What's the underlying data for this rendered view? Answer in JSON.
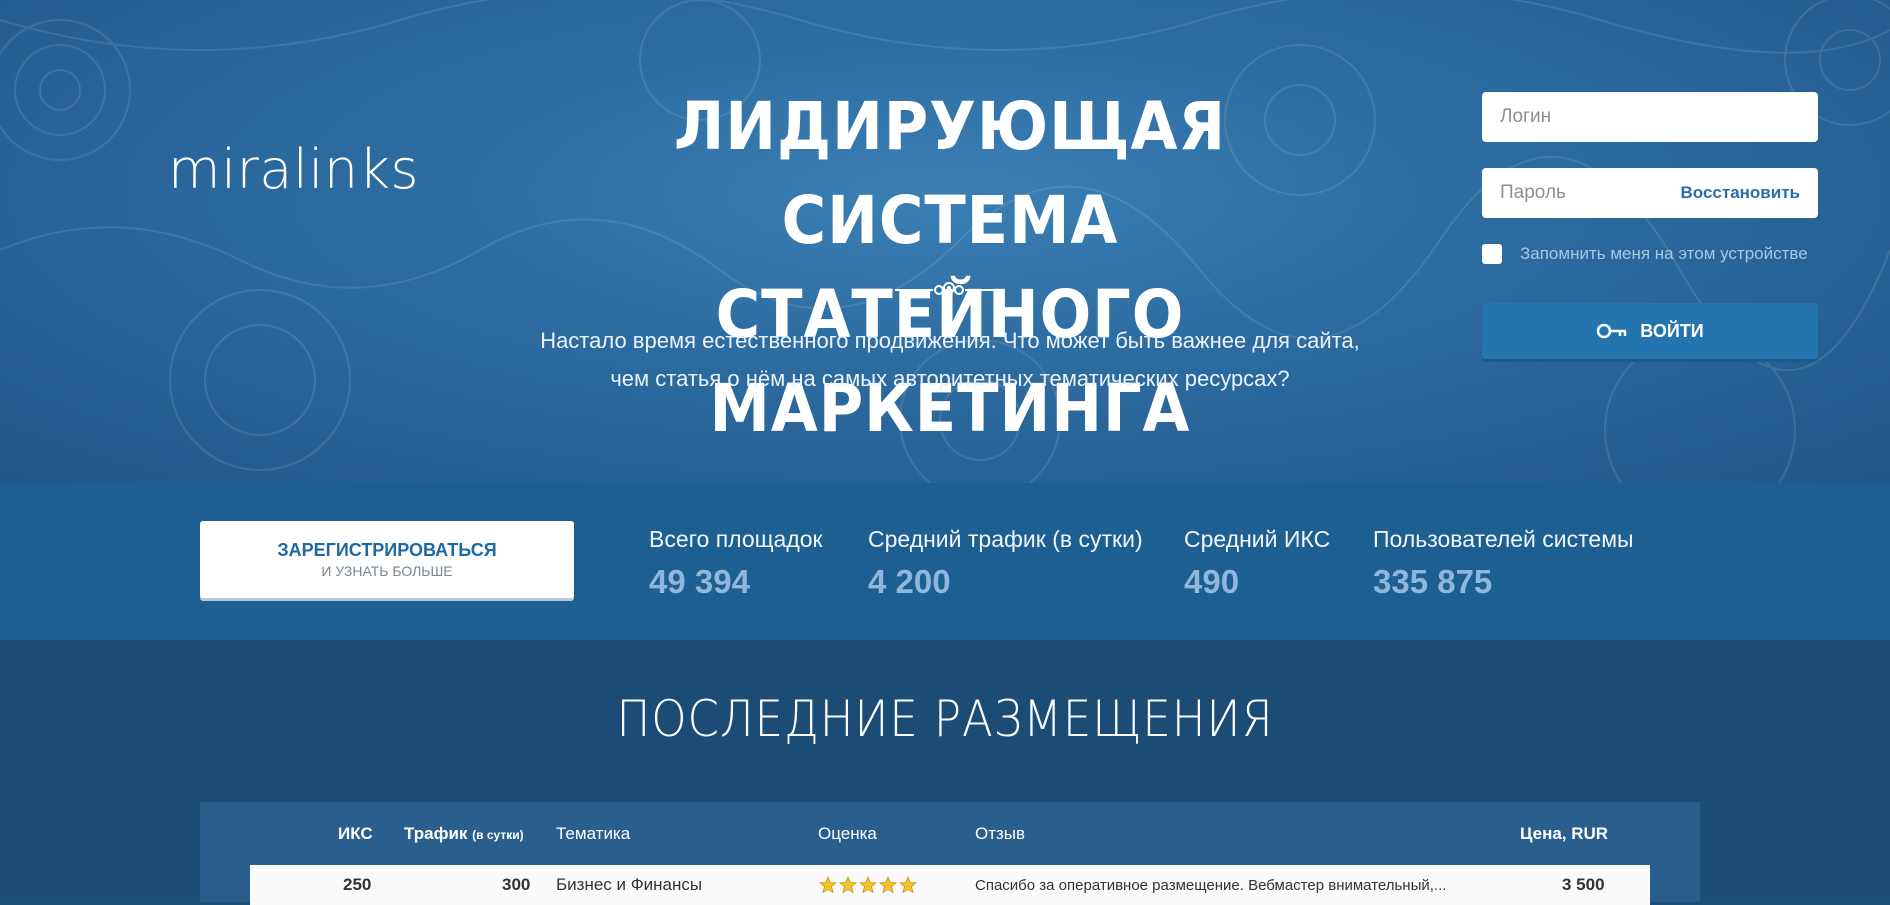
{
  "brand": {
    "logo": "miralinks"
  },
  "hero": {
    "headline_line1": "ЛИДИРУЮЩАЯ СИСТЕМА",
    "headline_line2": "СТАТЕЙНОГО МАРКЕТИНГА",
    "subtitle_line1": "Настало время естественного продвижения. Что может быть важнее для сайта,",
    "subtitle_line2": "чем статья о нём на самых авторитетных тематических ресурсах?"
  },
  "login": {
    "login_placeholder": "Логин",
    "password_placeholder": "Пароль",
    "restore_link": "Восстановить",
    "remember_label": "Запомнить меня на этом устройстве",
    "submit_label": "ВОЙТИ"
  },
  "register": {
    "main_label": "ЗАРЕГИСТРИРОВАТЬСЯ",
    "sub_label": "И УЗНАТЬ БОЛЬШЕ"
  },
  "stats": [
    {
      "label": "Всего площадок",
      "value": "49 394"
    },
    {
      "label": "Средний трафик (в сутки)",
      "value": "4 200"
    },
    {
      "label": "Средний ИКС",
      "value": "490"
    },
    {
      "label": "Пользователей системы",
      "value": "335 875"
    }
  ],
  "latest": {
    "title": "ПОСЛЕДНИЕ РАЗМЕЩЕНИЯ",
    "headers": {
      "iks": "ИКС",
      "traffic": "Трафик",
      "traffic_note": "(в сутки)",
      "topic": "Тематика",
      "rating": "Оценка",
      "review": "Отзыв",
      "price": "Цена, RUR"
    },
    "rows": [
      {
        "iks": "250",
        "traffic": "300",
        "topic": "Бизнес и Финансы",
        "rating": 5,
        "review": "Спасибо за оперативное размещение. Вебмастер внимательный,...",
        "price": "3 500"
      }
    ]
  },
  "colors": {
    "accent": "#2474b0",
    "star": "#f2c230"
  }
}
